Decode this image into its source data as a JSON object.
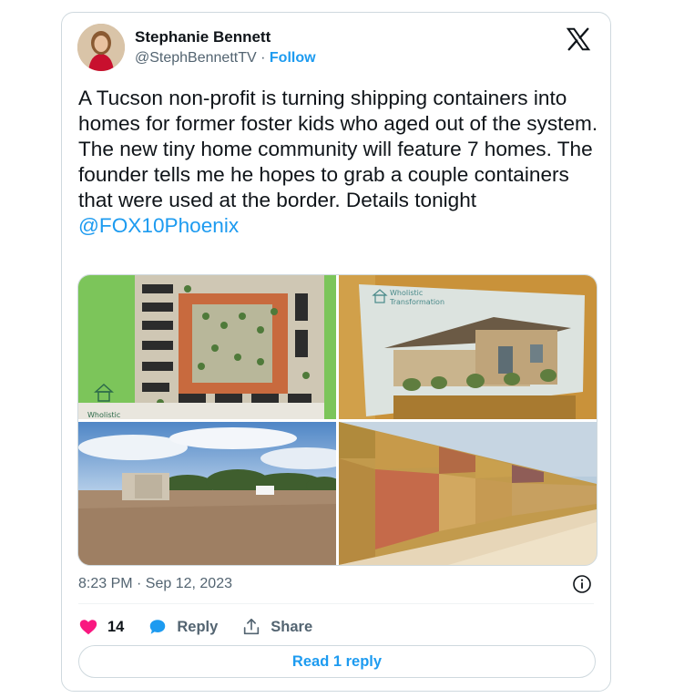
{
  "author": {
    "name": "Stephanie Bennett",
    "handle": "@StephBennettTV",
    "separator": "·",
    "follow_label": "Follow"
  },
  "tweet": {
    "text": "A Tucson non-profit is turning shipping containers into homes for former foster kids who aged out of the system. The new tiny home community will feature 7 homes. The founder tells me he hopes to grab a couple containers that were used at the border. Details tonight ",
    "mention": "@FOX10Phoenix",
    "timestamp": "8:23 PM · Sep 12, 2023"
  },
  "media": {
    "photo1_logo_text": "Wholistic",
    "photo2_logo_text_1": "Wholistic",
    "photo2_logo_text_2": "Transformation"
  },
  "actions": {
    "likes_count": "14",
    "reply_label": "Reply",
    "share_label": "Share"
  },
  "read_replies_label": "Read 1 reply",
  "colors": {
    "accent": "#1d9bf0",
    "like": "#f91880",
    "text": "#0f1419",
    "secondary": "#536471"
  },
  "icons": [
    "x-logo-icon",
    "info-icon",
    "heart-icon",
    "reply-bubble-icon",
    "share-icon"
  ]
}
